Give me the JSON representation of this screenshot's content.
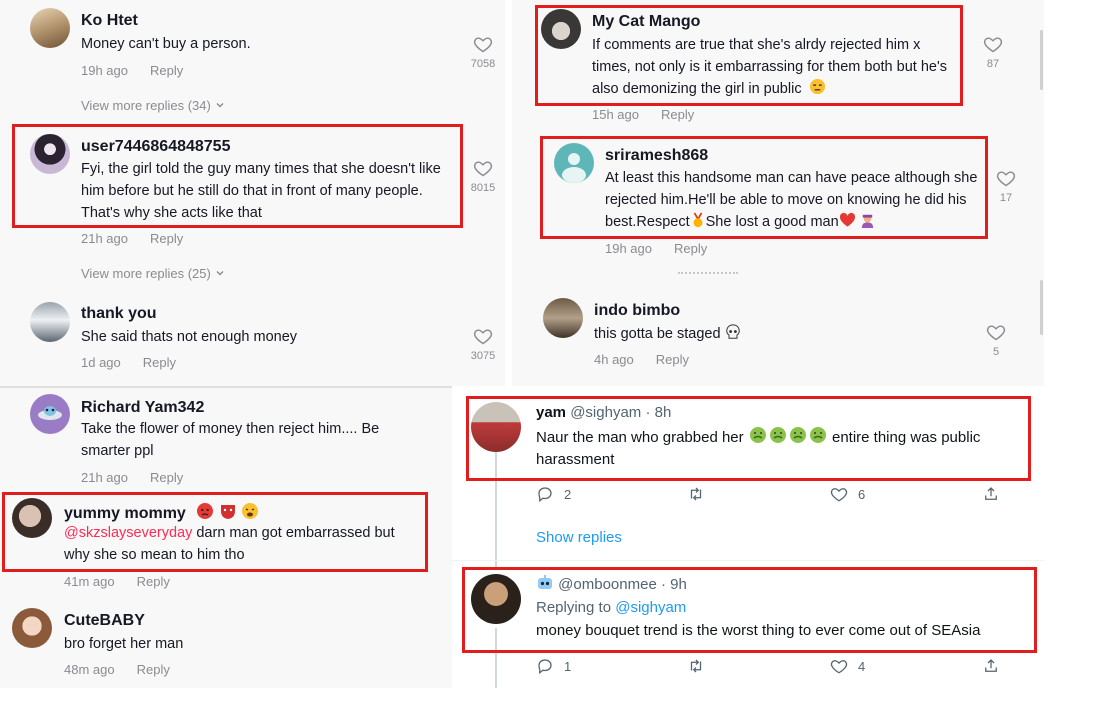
{
  "tiktok_left": [
    {
      "name": "Ko Htet",
      "text": "Money can't buy a person.",
      "time": "19h ago",
      "reply": "Reply",
      "likes": "7058"
    },
    {
      "name": "user7446864848755",
      "text": "Fyi, the girl told the guy many times that she doesn't like him before but he still do that in front of many people. That's why she acts like that",
      "time": "21h ago",
      "reply": "Reply",
      "likes": "8015"
    },
    {
      "name": "thank you",
      "text": "She said thats not enough money",
      "time": "1d ago",
      "reply": "Reply",
      "likes": "3075"
    },
    {
      "name": "Richard Yam342",
      "text": "Take the flower of money then reject him.... Be smarter ppl",
      "time": "21h ago",
      "reply": "Reply"
    },
    {
      "name": "yummy mommy",
      "mention": "@skzslayseveryday",
      "text": " darn man got embarrassed but why she so mean to him tho",
      "time": "41m ago",
      "reply": "Reply"
    },
    {
      "name": "CuteBABY",
      "text": "bro forget her man",
      "time": "48m ago",
      "reply": "Reply"
    }
  ],
  "view_more_1": "View more replies (34)",
  "view_more_2": "View more replies (25)",
  "tiktok_right": [
    {
      "name": "My Cat Mango",
      "text": "If comments are true that she's alrdy rejected him x times, not only is it embarrassing for them both but he's also demonizing the girl in public",
      "time": "15h ago",
      "reply": "Reply",
      "likes": "87"
    },
    {
      "name": "sriramesh868",
      "text": "At least this handsome man can have peace although she rejected him.He'll be able to move on knowing he did his best.Respect",
      "text2": "She lost a good man",
      "time": "19h ago",
      "reply": "Reply",
      "likes": "17"
    },
    {
      "name": "indo bimbo",
      "text": "this gotta be staged",
      "time": "4h ago",
      "reply": "Reply",
      "likes": "5"
    }
  ],
  "tweets": [
    {
      "name": "yam",
      "handle": "@sighyam",
      "time": "· 8h",
      "text_a": "Naur the man who grabbed her",
      "text_b": "entire thing was public harassment",
      "replies": "2",
      "likes": "6"
    },
    {
      "handle": "@omboonmee",
      "time": "· 9h",
      "replying_label": "Replying to",
      "replying_to": "@sighyam",
      "text": "money bouquet trend is the worst thing to ever come out of SEAsia",
      "replies": "1",
      "likes": "4"
    }
  ],
  "show_replies": "Show replies",
  "colors": {
    "highlight": "#e11d1d",
    "tiktok_mention": "#fe2c55",
    "twitter_link": "#1d9bf0"
  }
}
